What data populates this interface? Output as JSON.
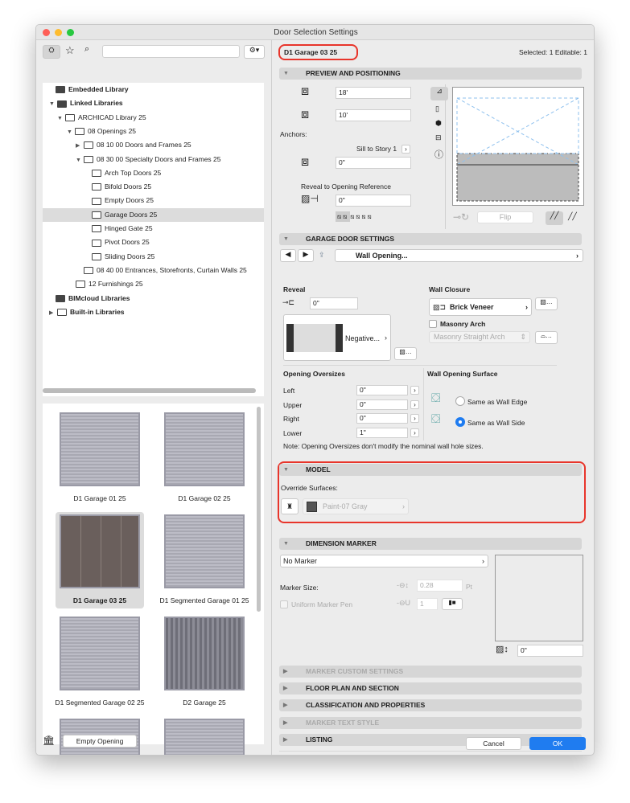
{
  "window": {
    "title": "Door Selection Settings"
  },
  "left": {
    "search_placeholder": "",
    "tree": [
      {
        "label": "Embedded Library"
      },
      {
        "label": "Linked Libraries"
      },
      {
        "label": "ARCHICAD Library 25"
      },
      {
        "label": "08 Openings 25"
      },
      {
        "label": "08 10 00 Doors and Frames 25"
      },
      {
        "label": "08 30 00 Specialty Doors and Frames 25"
      },
      {
        "label": "Arch Top Doors 25"
      },
      {
        "label": "Bifold Doors 25"
      },
      {
        "label": "Empty Doors 25"
      },
      {
        "label": "Garage Doors 25"
      },
      {
        "label": "Hinged Gate 25"
      },
      {
        "label": "Pivot Doors 25"
      },
      {
        "label": "Sliding Doors 25"
      },
      {
        "label": "08 40 00 Entrances, Storefronts, Curtain Walls 25"
      },
      {
        "label": "12 Furnishings 25"
      },
      {
        "label": "BIMcloud Libraries"
      },
      {
        "label": "Built-in Libraries"
      }
    ],
    "thumbnails": [
      {
        "label": "D1 Garage 01 25"
      },
      {
        "label": "D1 Garage 02 25"
      },
      {
        "label": "D1 Garage 03 25",
        "selected": true
      },
      {
        "label": "D1 Segmented Garage 01 25"
      },
      {
        "label": "D1 Segmented Garage 02 25"
      },
      {
        "label": "D2 Garage 25"
      }
    ],
    "empty_opening": "Empty Opening"
  },
  "header": {
    "name": "D1 Garage 03 25",
    "selected": "Selected: 1 Editable: 1",
    "highlight": "#e8352b"
  },
  "preview": {
    "title": "PREVIEW AND POSITIONING",
    "width": "18'",
    "height": "10'",
    "anchors": "Anchors:",
    "sill": "Sill to Story 1",
    "sill_value": "0\"",
    "reveal_ref": "Reveal to Opening Reference",
    "reveal_value": "0\"",
    "flip": "Flip"
  },
  "garage": {
    "title": "GARAGE DOOR SETTINGS",
    "page": "Wall Opening...",
    "reveal": "Reveal",
    "reveal_value": "0\"",
    "reveal_type": "Negative...",
    "wall_closure": "Wall Closure",
    "closure_value": "Brick Veneer",
    "masonry_arch": "Masonry Arch",
    "arch_type": "Masonry Straight Arch",
    "oversizes": "Opening Oversizes",
    "rows": [
      {
        "label": "Left",
        "value": "0\""
      },
      {
        "label": "Upper",
        "value": "0\""
      },
      {
        "label": "Right",
        "value": "0\""
      },
      {
        "label": "Lower",
        "value": "1\""
      }
    ],
    "surface": "Wall Opening Surface",
    "opt1": "Same as Wall Edge",
    "opt2": "Same as Wall Side",
    "selected_option": "Same as Wall Side",
    "note": "Note: Opening Oversizes don't modify the nominal wall hole sizes."
  },
  "model": {
    "title": "MODEL",
    "override": "Override Surfaces:",
    "surface": "Paint-07 Gray"
  },
  "dim": {
    "title": "DIMENSION MARKER",
    "marker": "No Marker",
    "size_label": "Marker Size:",
    "size": "0.28",
    "unit": "Pt",
    "uniform": "Uniform Marker Pen",
    "pen": "1",
    "offset": "0\""
  },
  "sections": [
    {
      "label": "MARKER CUSTOM SETTINGS",
      "disabled": true
    },
    {
      "label": "FLOOR PLAN AND SECTION"
    },
    {
      "label": "CLASSIFICATION AND PROPERTIES"
    },
    {
      "label": "MARKER TEXT STYLE",
      "disabled": true
    },
    {
      "label": "LISTING"
    }
  ],
  "footer": {
    "cancel": "Cancel",
    "ok": "OK",
    "accent": "#1f7cf0"
  }
}
